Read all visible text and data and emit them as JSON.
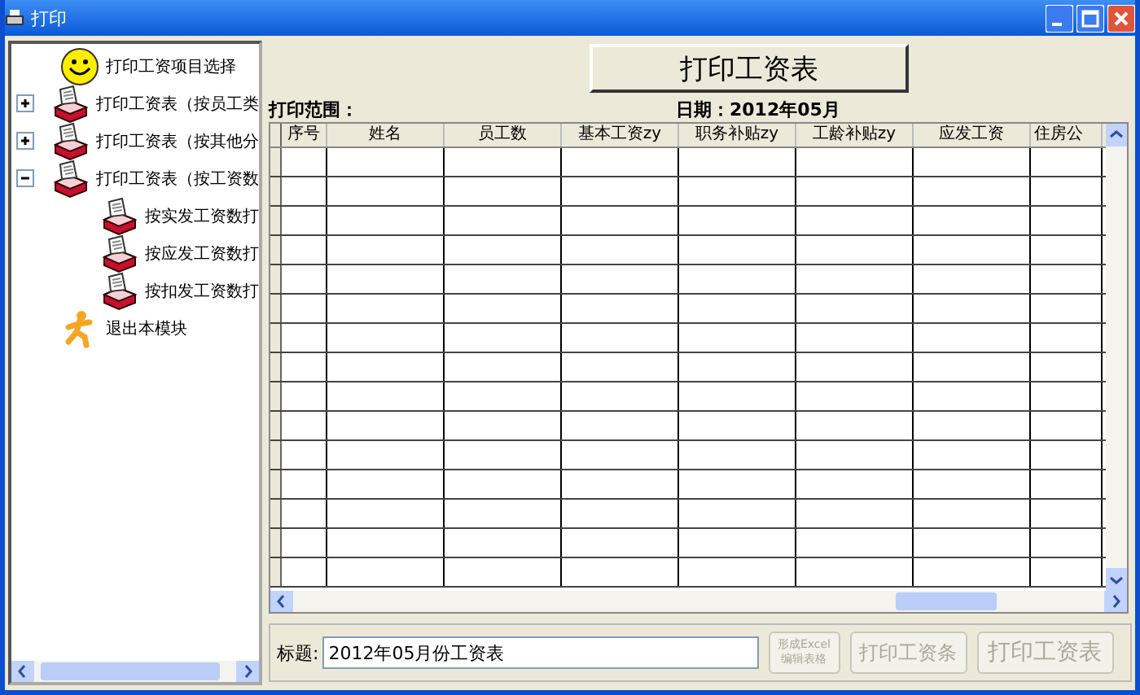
{
  "window": {
    "title": "打印"
  },
  "tree": [
    {
      "label": "打印工资项目选择",
      "kind": "smiley"
    },
    {
      "label": "打印工资表（按员工类",
      "kind": "printer",
      "expanded": false
    },
    {
      "label": "打印工资表（按其他分",
      "kind": "printer",
      "expanded": false
    },
    {
      "label": "打印工资表（按工资数",
      "kind": "printer",
      "expanded": true,
      "children": [
        {
          "label": "按实发工资数打",
          "kind": "printer"
        },
        {
          "label": "按应发工资数打",
          "kind": "printer"
        },
        {
          "label": "按扣发工资数打",
          "kind": "printer"
        }
      ]
    },
    {
      "label": "退出本模块",
      "kind": "runner"
    }
  ],
  "print_button": {
    "label": "打印工资表"
  },
  "range_label": "打印范围：",
  "date_label": "日期：2012年05月",
  "table": {
    "columns": [
      "序号",
      "姓名",
      "员工数",
      "基本工资zy",
      "职务补贴zy",
      "工龄补贴zy",
      "应发工资",
      "住房公"
    ]
  },
  "title_field": {
    "label": "标题:",
    "value": "2012年05月份工资表"
  },
  "buttons": [
    {
      "label": "形成Excel\n编辑表格",
      "disabled": true,
      "kind": "small"
    },
    {
      "label": "打印工资条",
      "disabled": true,
      "kind": "medium"
    },
    {
      "label": "打印工资表",
      "disabled": true,
      "kind": "large"
    }
  ]
}
